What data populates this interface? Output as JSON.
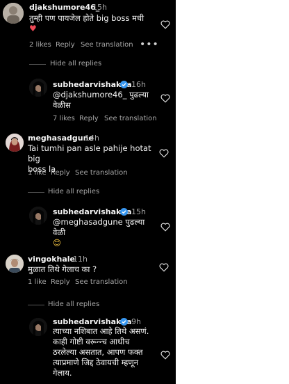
{
  "threads": [
    {
      "comment": {
        "username": "djakshumore46_",
        "time": "15h",
        "text": "तुम्ही पण पायजेल होते big boss मधी",
        "emoji": "♥",
        "likes": "2 likes",
        "reply": "Reply",
        "see_translation": "See translation",
        "more": "•••"
      },
      "hide_replies": "Hide all replies",
      "reply": {
        "username": "subhedarvishakha",
        "time": "16h",
        "text_line1": "@djakshumore46_ पुढल्या",
        "text_line2": "वेळीस",
        "likes": "7 likes",
        "reply": "Reply",
        "see_translation": "See translation"
      }
    },
    {
      "comment": {
        "username": "meghasadgune",
        "time": "14h",
        "text_line1": "Tai tumhi pan asle pahije hotat big",
        "text_line2": "boss la",
        "likes": "1 like",
        "reply": "Reply",
        "see_translation": "See translation"
      },
      "hide_replies": "Hide all replies",
      "reply": {
        "username": "subhedarvishakha",
        "time": "15h",
        "text_line1": "@meghasadgune पुढल्या वेळी",
        "emoji": "😊"
      }
    },
    {
      "comment": {
        "username": "vingokhale",
        "time": "11h",
        "text": "मुळात तिथे गेलाच का ?",
        "likes": "1 like",
        "reply": "Reply",
        "see_translation": "See translation"
      },
      "hide_replies": "Hide all replies",
      "reply": {
        "username": "subhedarvishakha",
        "time": "9h",
        "text_line1": "त्याच्या नशिबात आहे तिथे असणं.",
        "text_line2": "काही गोष्टी वरून्न्च आधीच",
        "text_line3": "ठरलेल्या असतात, आपण फक्त",
        "text_line4": "त्याप्रमाणे जिद्द ठेवायची म्हणून",
        "text_line5": "गेलाय."
      }
    }
  ],
  "colors": {
    "background": "#000000",
    "text": "#f5f5f5",
    "muted": "#a8a8a8",
    "verified": "#3897f0",
    "heart_red": "#ed4956"
  }
}
